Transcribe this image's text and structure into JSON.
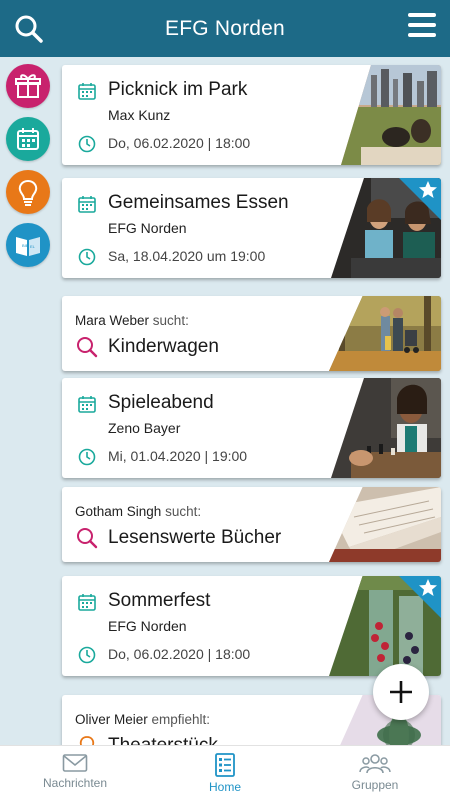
{
  "header": {
    "title": "EFG Norden"
  },
  "sidebar": {
    "items": [
      {
        "name": "gift",
        "color": "#c8226d"
      },
      {
        "name": "calendar",
        "color": "#1aa99c"
      },
      {
        "name": "idea",
        "color": "#e87818"
      },
      {
        "name": "bible",
        "color": "#1f93c6"
      }
    ]
  },
  "cards": [
    {
      "type": "event",
      "title": "Picknick im Park",
      "organizer": "Max Kunz",
      "date": "Do, 06.02.2020 | 18:00",
      "starred": false
    },
    {
      "type": "event",
      "title": "Gemeinsames Essen",
      "organizer": "EFG Norden",
      "date": "Sa, 18.04.2020 um 19:00",
      "starred": true
    },
    {
      "type": "request",
      "person": "Mara Weber",
      "verb": "sucht:",
      "title": "Kinderwagen"
    },
    {
      "type": "event",
      "title": "Spieleabend",
      "organizer": "Zeno Bayer",
      "date": "Mi, 01.04.2020 | 19:00",
      "starred": false
    },
    {
      "type": "request",
      "person": "Gotham Singh",
      "verb": "sucht:",
      "title": "Lesenswerte Bücher"
    },
    {
      "type": "event",
      "title": "Sommerfest",
      "organizer": "EFG Norden",
      "date": "Do, 06.02.2020 | 18:00",
      "starred": true
    },
    {
      "type": "recommend",
      "person": "Oliver Meier",
      "verb": "empfiehlt:",
      "title": "Theaterstück"
    }
  ],
  "nav": {
    "tabs": [
      {
        "label": "Nachrichten",
        "icon": "envelope-icon",
        "active": false
      },
      {
        "label": "Home",
        "icon": "list-icon",
        "active": true
      },
      {
        "label": "Gruppen",
        "icon": "people-icon",
        "active": false
      }
    ]
  },
  "colors": {
    "header": "#1d6a87",
    "accent": "#1f93c6",
    "teal": "#1aa99c",
    "magenta": "#c8226d",
    "orange": "#e87818"
  }
}
